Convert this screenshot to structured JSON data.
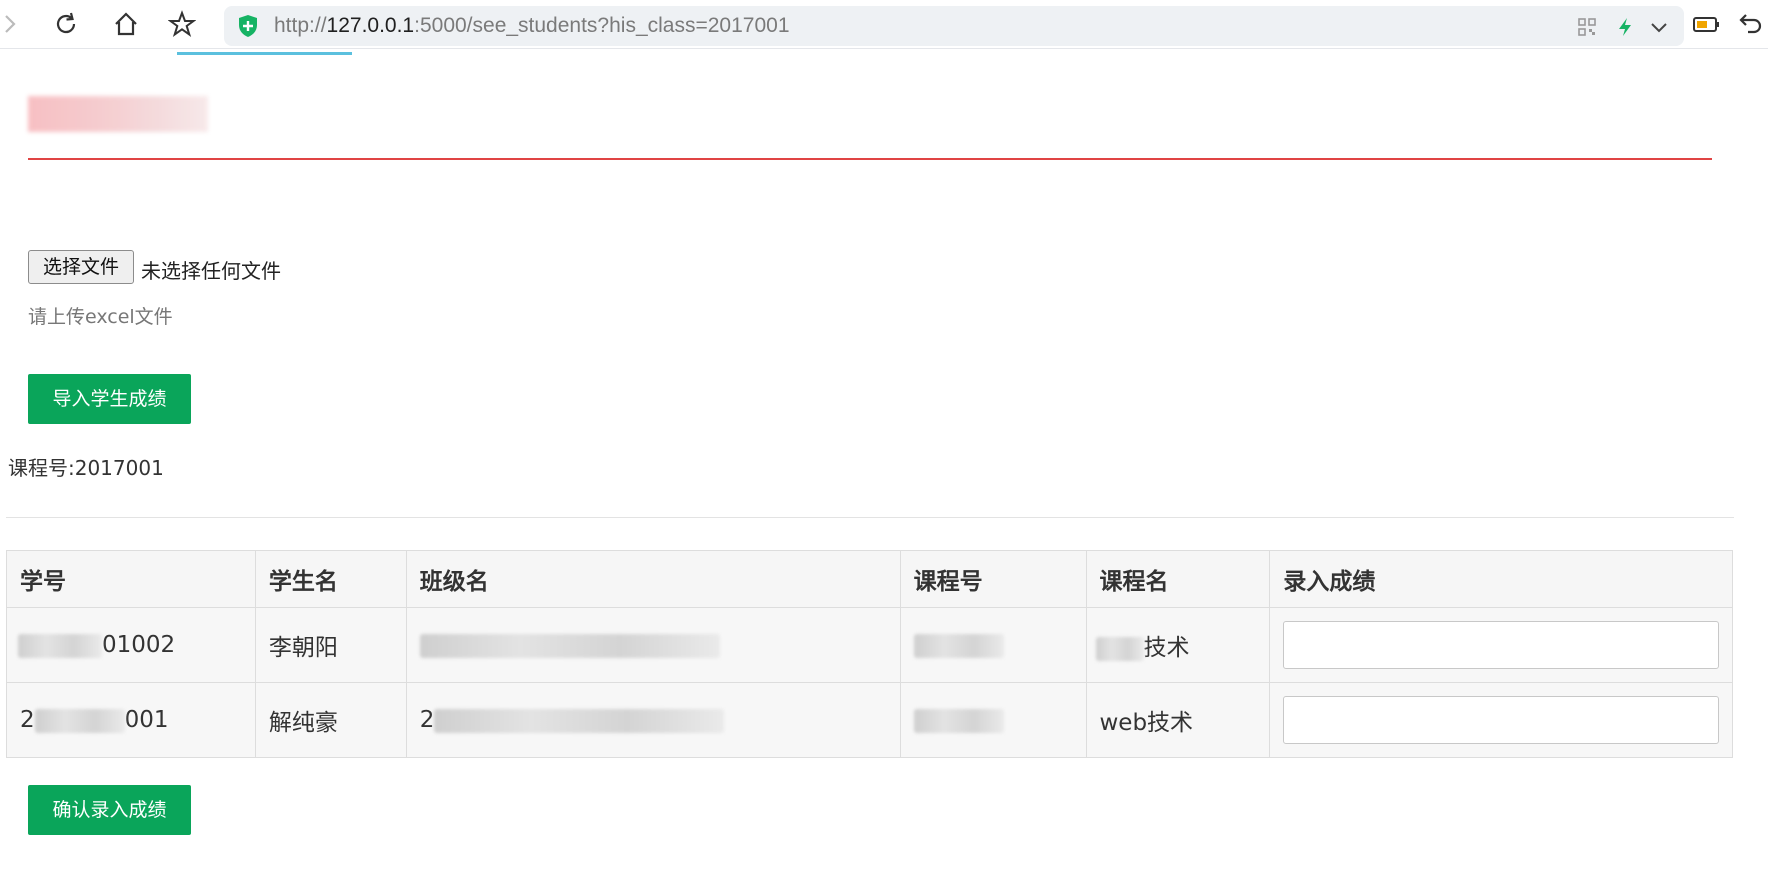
{
  "browser": {
    "url_scheme": "http://",
    "url_host": "127.0.0.1",
    "url_rest": ":5000/see_students?his_class=2017001",
    "icons": [
      "forward-icon",
      "reload-icon",
      "home-icon",
      "star-icon",
      "shield-icon",
      "qr-icon",
      "bolt-icon",
      "chevron-down-icon",
      "battery-icon",
      "undo-icon"
    ]
  },
  "upload": {
    "choose_file_label": "选择文件",
    "no_file_text": "未选择任何文件",
    "hint": "请上传excel文件",
    "import_button": "导入学生成绩"
  },
  "course": {
    "label": "课程号:2017001"
  },
  "table": {
    "headers": [
      "学号",
      "学生名",
      "班级名",
      "课程号",
      "课程名",
      "录入成绩"
    ],
    "rows": [
      {
        "id_suffix": "01002",
        "name": "李朝阳",
        "class_visible": "",
        "course_no_visible": "",
        "course_name_suffix": "技术",
        "score": ""
      },
      {
        "id_prefix": "2",
        "id_suffix": "001",
        "name": "解纯豪",
        "class_visible": "2",
        "course_no_visible": "",
        "course_name": "web技术",
        "score": ""
      }
    ]
  },
  "submit": {
    "button": "确认录入成绩"
  },
  "colors": {
    "accent_green": "#0aa55a",
    "divider_red": "#e04444"
  }
}
